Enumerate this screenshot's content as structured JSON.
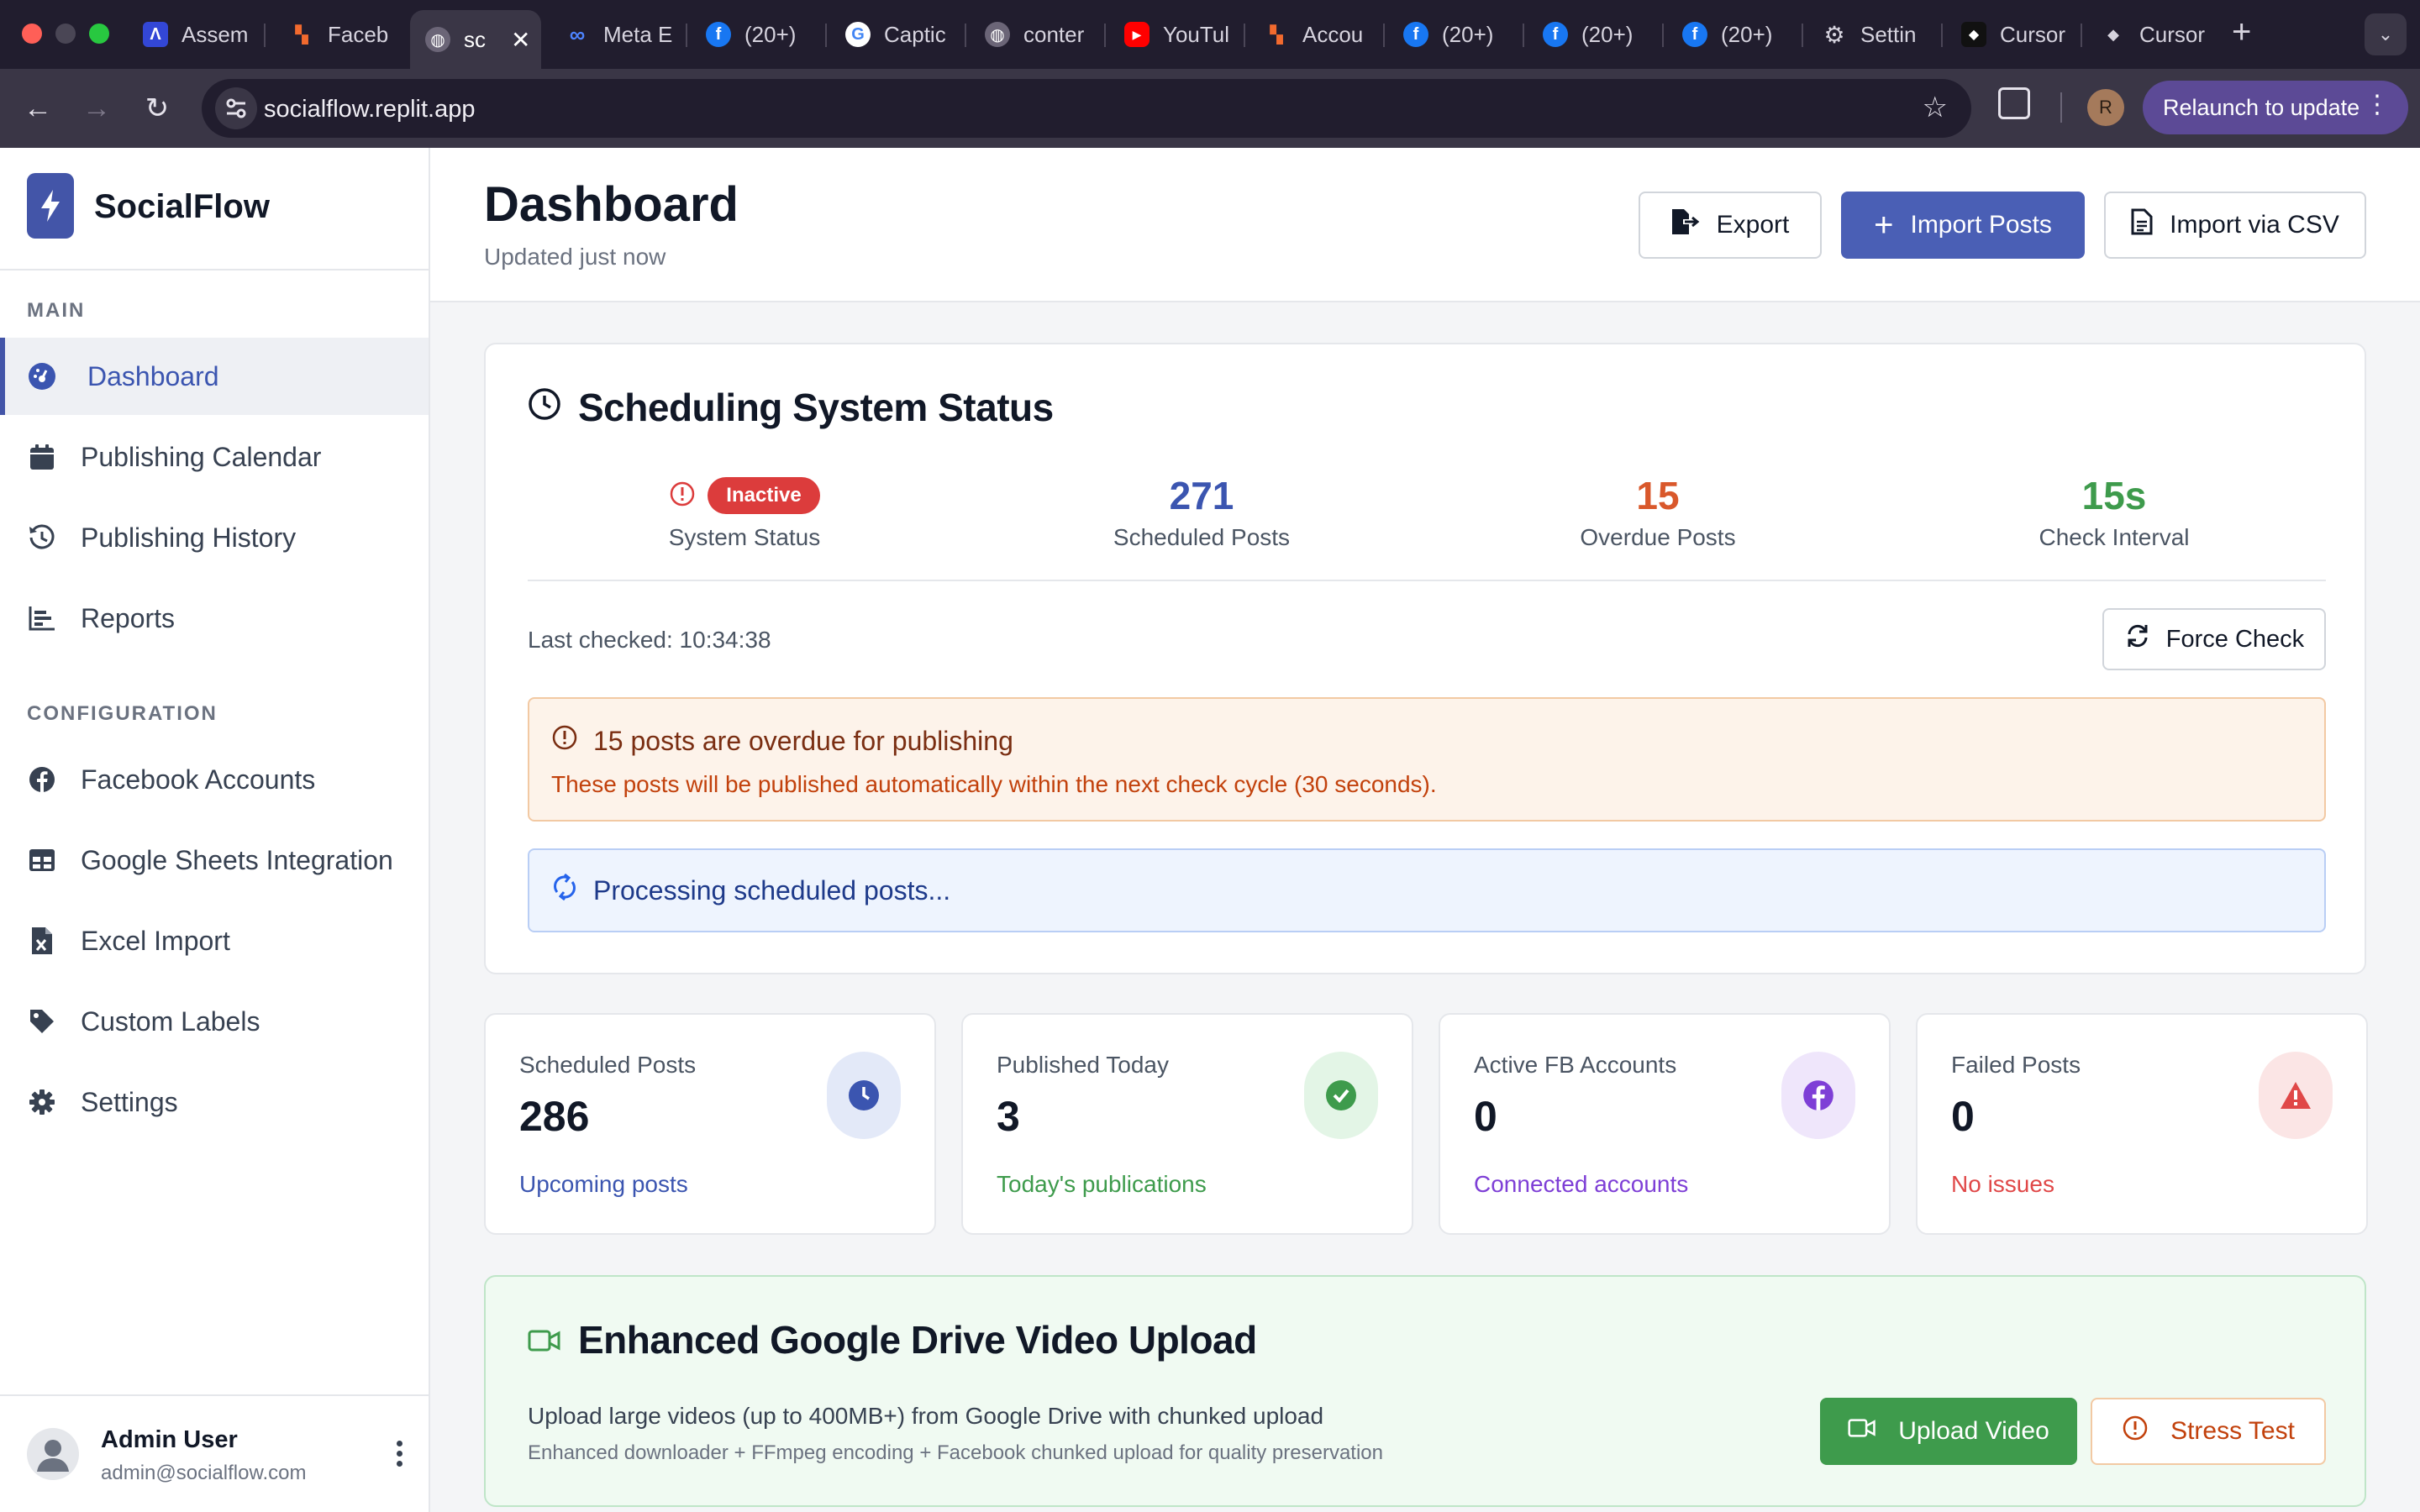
{
  "browser": {
    "tabs": [
      {
        "label": "Assem",
        "icon": "a-logo-icon"
      },
      {
        "label": "Faceb",
        "icon": "dotgrid-icon"
      },
      {
        "label": "sc",
        "icon": "globe-icon",
        "active": true
      },
      {
        "label": "Meta E",
        "icon": "meta-icon"
      },
      {
        "label": "(20+)",
        "icon": "facebook-icon"
      },
      {
        "label": "Captic",
        "icon": "google-icon"
      },
      {
        "label": "conter",
        "icon": "globe-icon"
      },
      {
        "label": "YouTul",
        "icon": "youtube-icon"
      },
      {
        "label": "Accou",
        "icon": "dotgrid-icon"
      },
      {
        "label": "(20+)",
        "icon": "facebook-icon"
      },
      {
        "label": "(20+)",
        "icon": "facebook-icon"
      },
      {
        "label": "(20+)",
        "icon": "facebook-icon"
      },
      {
        "label": "Settin",
        "icon": "gear-icon"
      },
      {
        "label": "Cursor",
        "icon": "cursor-icon"
      },
      {
        "label": "Cursor",
        "icon": "cursor-icon"
      }
    ],
    "url": "socialflow.replit.app",
    "profile_initial": "R",
    "relaunch_label": "Relaunch to update"
  },
  "app": {
    "brand": "SocialFlow",
    "sections": {
      "main": "MAIN",
      "config": "CONFIGURATION"
    },
    "nav_main": [
      {
        "label": "Dashboard",
        "icon": "dashboard-gauge-icon",
        "active": true
      },
      {
        "label": "Publishing Calendar",
        "icon": "calendar-icon"
      },
      {
        "label": "Publishing History",
        "icon": "history-icon"
      },
      {
        "label": "Reports",
        "icon": "bar-chart-icon"
      }
    ],
    "nav_config": [
      {
        "label": "Facebook Accounts",
        "icon": "facebook-icon"
      },
      {
        "label": "Google Sheets Integration",
        "icon": "table-icon"
      },
      {
        "label": "Excel Import",
        "icon": "excel-file-icon"
      },
      {
        "label": "Custom Labels",
        "icon": "tag-icon"
      },
      {
        "label": "Settings",
        "icon": "gear-icon"
      }
    ],
    "user": {
      "name": "Admin User",
      "email": "admin@socialflow.com"
    }
  },
  "header": {
    "title": "Dashboard",
    "subtitle": "Updated just now",
    "export_label": "Export",
    "import_label": "Import Posts",
    "csv_label": "Import via CSV"
  },
  "scheduler": {
    "title": "Scheduling System Status",
    "status_badge": "Inactive",
    "status_label": "System Status",
    "scheduled_value": "271",
    "scheduled_label": "Scheduled Posts",
    "overdue_value": "15",
    "overdue_label": "Overdue Posts",
    "interval_value": "15s",
    "interval_label": "Check Interval",
    "last_checked": "Last checked: 10:34:38",
    "force_label": "Force Check",
    "warning_title": "15 posts are overdue for publishing",
    "warning_body": "These posts will be published automatically within the next check cycle (30 seconds).",
    "processing": "Processing scheduled posts..."
  },
  "stats": [
    {
      "label": "Scheduled Posts",
      "value": "286",
      "foot": "Upcoming posts",
      "icon": "clock-icon",
      "color": "#3b55b0",
      "bg": "#e3e9f8"
    },
    {
      "label": "Published Today",
      "value": "3",
      "foot": "Today's publications",
      "icon": "check-circle-icon",
      "color": "#3e9b4c",
      "bg": "#e3f5e6"
    },
    {
      "label": "Active FB Accounts",
      "value": "0",
      "foot": "Connected accounts",
      "icon": "facebook-icon",
      "color": "#7e3fd6",
      "bg": "#efe6fb"
    },
    {
      "label": "Failed Posts",
      "value": "0",
      "foot": "No issues",
      "icon": "warning-triangle-icon",
      "color": "#e04848",
      "bg": "#fbe5e5"
    }
  ],
  "drive": {
    "title": "Enhanced Google Drive Video Upload",
    "desc": "Upload large videos (up to 400MB+) from Google Drive with chunked upload",
    "sub": "Enhanced downloader + FFmpeg encoding + Facebook chunked upload for quality preservation",
    "upload_label": "Upload Video",
    "stress_label": "Stress Test"
  },
  "colors": {
    "primary": "#4a5fb5",
    "overdue": "#d9582b",
    "interval": "#3e9b4c",
    "scheduled": "#3b55b0",
    "danger": "#dc3c3c"
  }
}
